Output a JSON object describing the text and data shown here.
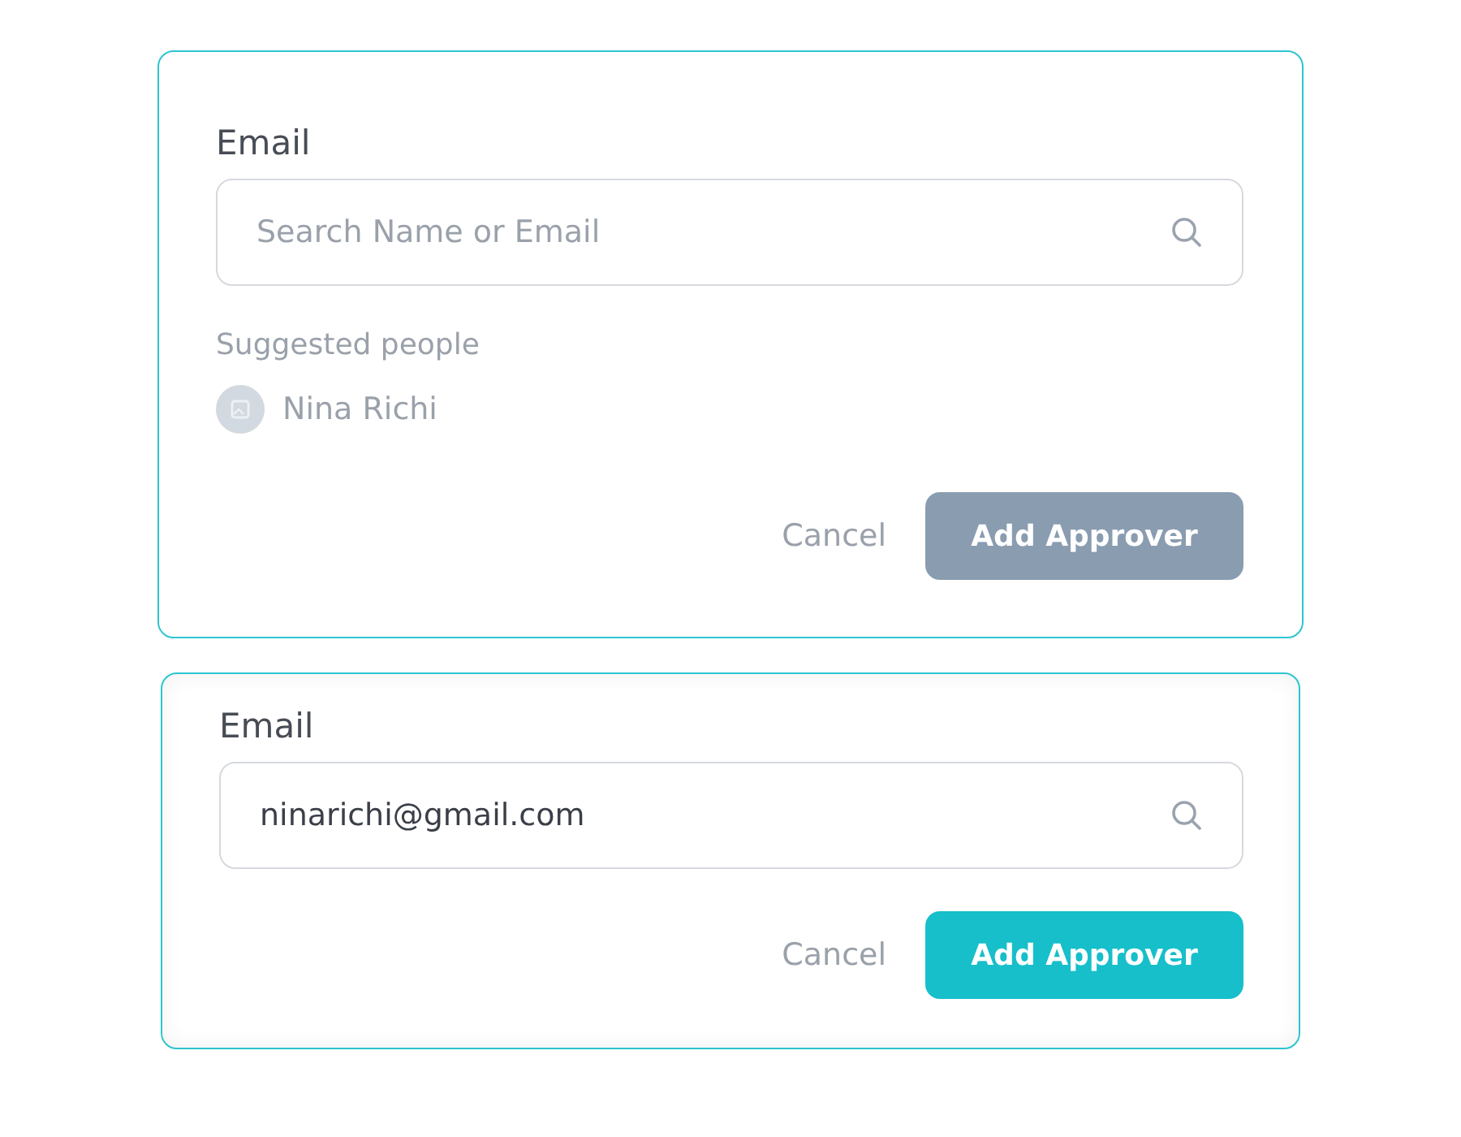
{
  "cards": [
    {
      "label": "Email",
      "field": {
        "placeholder": "Search Name or Email"
      },
      "suggestions": {
        "title": "Suggested people",
        "people": [
          {
            "name": "Nina Richi"
          }
        ]
      },
      "cancel": "Cancel",
      "submit": {
        "label": "Add Approver",
        "disabled": true
      }
    },
    {
      "label": "Email",
      "field": {
        "value": "ninarichi@gmail.com"
      },
      "cancel": "Cancel",
      "submit": {
        "label": "Add Approver",
        "disabled": false
      }
    }
  ]
}
